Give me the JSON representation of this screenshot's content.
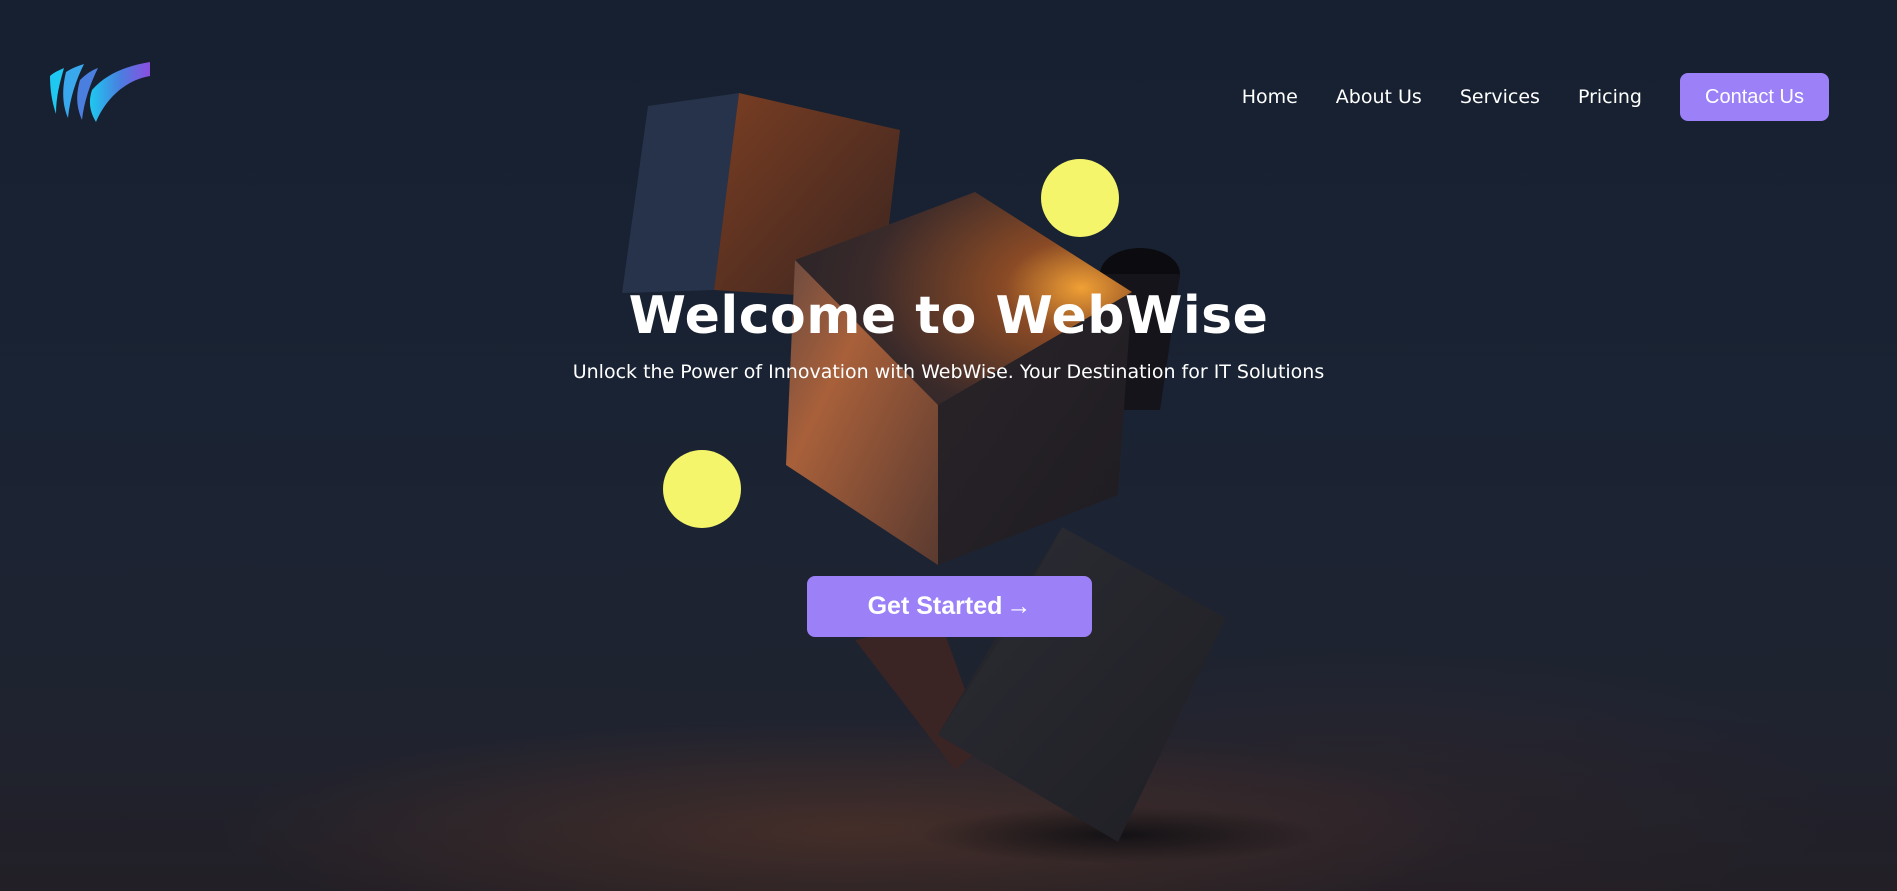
{
  "brand": {
    "logo_name": "webwise-logo",
    "colors": {
      "logo_start": "#1ec8f0",
      "logo_mid": "#4a7fe0",
      "logo_end": "#8a4fe0"
    }
  },
  "nav": {
    "items": [
      {
        "label": "Home"
      },
      {
        "label": "About Us"
      },
      {
        "label": "Services"
      },
      {
        "label": "Pricing"
      }
    ],
    "contact_label": "Contact Us"
  },
  "hero": {
    "title": "Welcome to WebWise",
    "subtitle": "Unlock the Power of Innovation with WebWise. Your Destination for IT Solutions",
    "cta_label": "Get Started",
    "cta_arrow": "→"
  },
  "theme": {
    "accent": "#9b80f7",
    "background": "#172030",
    "orb_color": "#f4f56a"
  }
}
